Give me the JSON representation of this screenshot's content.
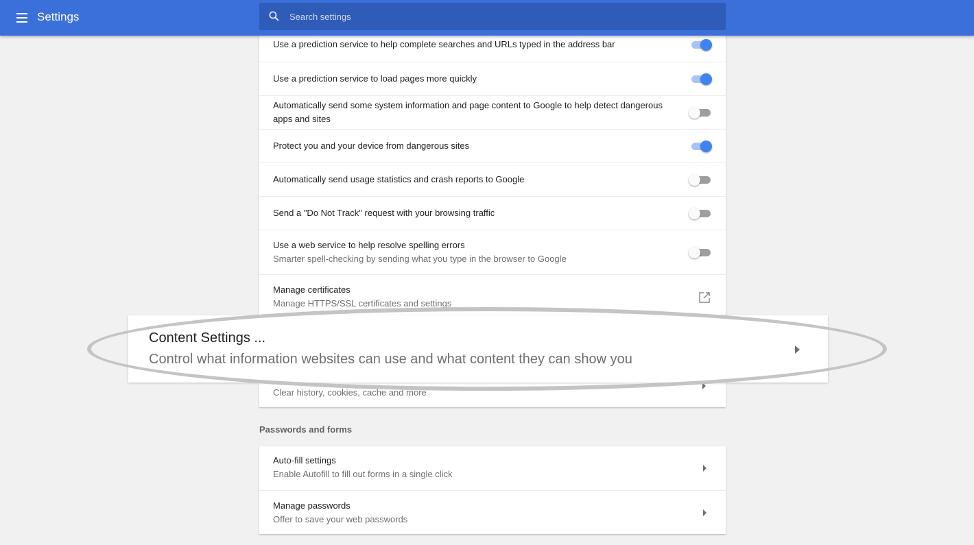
{
  "header": {
    "title": "Settings",
    "search_placeholder": "Search settings"
  },
  "privacy": {
    "rows": [
      {
        "title": "Use a prediction service to help complete searches and URLs typed in the address bar",
        "toggle": "on"
      },
      {
        "title": "Use a prediction service to load pages more quickly",
        "toggle": "on"
      },
      {
        "title": "Automatically send some system information and page content to Google to help detect dangerous",
        "title2": "apps and sites",
        "toggle": "off"
      },
      {
        "title": "Protect you and your device from dangerous sites",
        "toggle": "on"
      },
      {
        "title": "Automatically send usage statistics and crash reports to Google",
        "toggle": "off"
      },
      {
        "title": "Send a \"Do Not Track\" request with your browsing traffic",
        "toggle": "off"
      },
      {
        "title": "Use a web service to help resolve spelling errors",
        "subtitle": "Smarter spell-checking by sending what you type in the browser to Google",
        "toggle": "off"
      },
      {
        "title": "Manage certificates",
        "subtitle": "Manage HTTPS/SSL certificates and settings",
        "icon": "open-in-new-icon"
      },
      {
        "subtitle": "Clear history, cookies, cache and more"
      }
    ]
  },
  "callout": {
    "title": "Content Settings ...",
    "subtitle": "Control what information websites can use and what content they can show you"
  },
  "passwords": {
    "heading": "Passwords and forms",
    "rows": [
      {
        "title": "Auto-fill settings",
        "subtitle": "Enable Autofill to fill out forms in a single click"
      },
      {
        "title": "Manage passwords",
        "subtitle": "Offer to save your web passwords"
      }
    ]
  },
  "colors": {
    "header_bg": "#3b6fd9",
    "toggle_on": "#3f83f1",
    "toggle_off": "#9e9e9e"
  }
}
